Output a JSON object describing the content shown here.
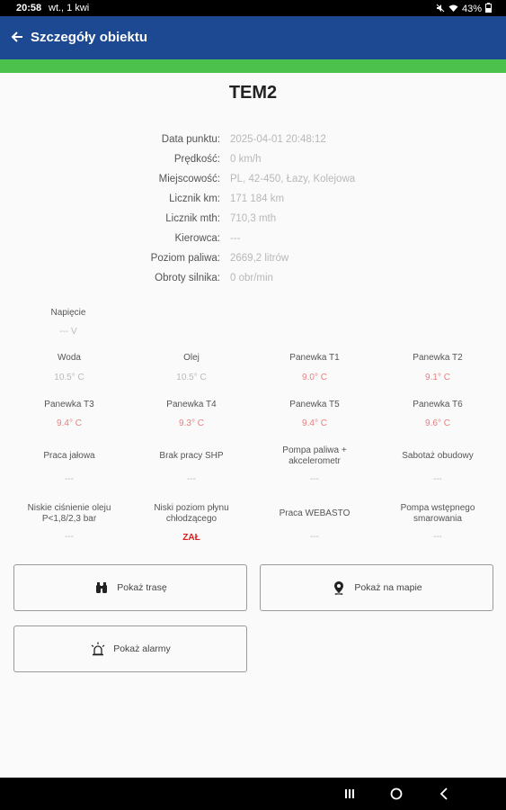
{
  "status_bar": {
    "time": "20:58",
    "date": "wt., 1 kwi",
    "battery": "43%"
  },
  "app_bar": {
    "title": "Szczegóły obiektu"
  },
  "object": {
    "name": "TEM2"
  },
  "details": [
    {
      "label": "Data punktu:",
      "value": "2025-04-01 20:48:12"
    },
    {
      "label": "Prędkość:",
      "value": "0 km/h"
    },
    {
      "label": "Miejscowość:",
      "value": "PL, 42-450, Łazy, Kolejowa"
    },
    {
      "label": "Licznik km:",
      "value": "171 184 km"
    },
    {
      "label": "Licznik mth:",
      "value": "710,3 mth"
    },
    {
      "label": "Kierowca:",
      "value": "---"
    },
    {
      "label": "Poziom paliwa:",
      "value": "2669,2 litrów"
    },
    {
      "label": "Obroty silnika:",
      "value": "0 obr/min"
    }
  ],
  "voltage": {
    "label": "Napięcie",
    "value": "--- V"
  },
  "temps_row1": [
    {
      "label": "Woda",
      "value": "10.5° C"
    },
    {
      "label": "Olej",
      "value": "10.5° C"
    },
    {
      "label": "Panewka T1",
      "value": "9.0° C"
    },
    {
      "label": "Panewka T2",
      "value": "9.1° C"
    }
  ],
  "temps_row2": [
    {
      "label": "Panewka T3",
      "value": "9.4° C"
    },
    {
      "label": "Panewka T4",
      "value": "9.3° C"
    },
    {
      "label": "Panewka T5",
      "value": "9.4° C"
    },
    {
      "label": "Panewka T6",
      "value": "9.6° C"
    }
  ],
  "status_row1": [
    {
      "label": "Praca jałowa",
      "value": "---"
    },
    {
      "label": "Brak pracy SHP",
      "value": "---"
    },
    {
      "label": "Pompa paliwa +\nakcelerometr",
      "value": "---"
    },
    {
      "label": "Sabotaż obudowy",
      "value": "---"
    }
  ],
  "status_row2": [
    {
      "label": "Niskie ciśnienie oleju\nP<1,8/2,3 bar",
      "value": "---"
    },
    {
      "label": "Niski poziom płynu\nchłodzącego",
      "value": "ZAŁ"
    },
    {
      "label": "Praca WEBASTO",
      "value": "---"
    },
    {
      "label": "Pompa wstępnego\nsmarowania",
      "value": "---"
    }
  ],
  "buttons": {
    "route": "Pokaż trasę",
    "map": "Pokaż na mapie",
    "alarms": "Pokaż alarmy"
  },
  "colors": {
    "app_bar": "#1d4892",
    "strip": "#4cc24d",
    "temp_red": "#e88080",
    "alarm_red": "#d62020"
  }
}
